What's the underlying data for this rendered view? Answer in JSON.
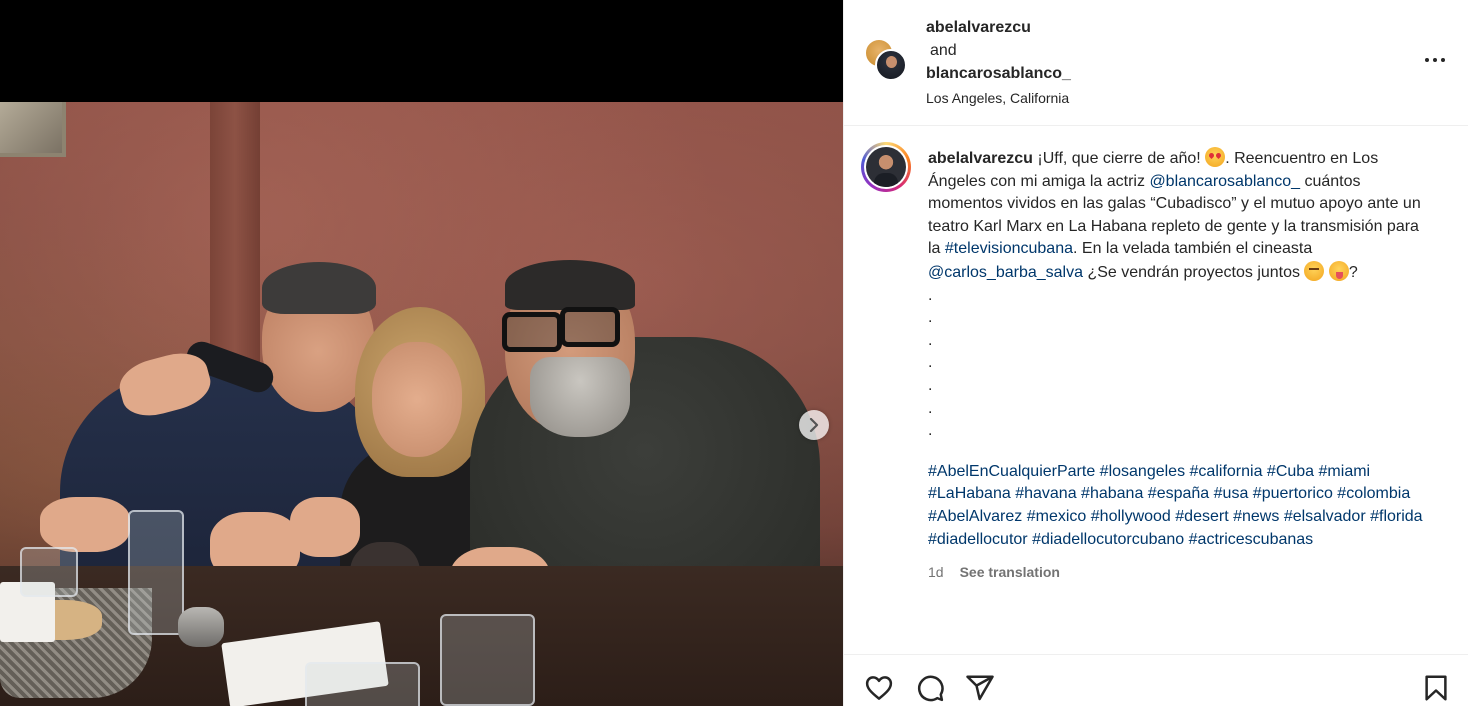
{
  "header": {
    "user1": "abelalvarezcu",
    "and_text": "and",
    "user2": "blancarosablanco_",
    "location": "Los Angeles, California"
  },
  "caption": {
    "username": "abelalvarezcu",
    "seg1": " ¡Uff, que cierre de año! ",
    "seg2": ". Reencuentro en Los Ángeles con mi amiga la actriz ",
    "mention1": "@blancarosablanco_",
    "seg3": " cuántos momentos vividos en las galas “Cubadisco” y el mutuo apoyo ante un teatro Karl Marx en La Habana repleto de gente y la transmisión para la ",
    "hashtag1": "#televisioncubana",
    "seg4": ". En la velada también el cineasta ",
    "mention2": "@carlos_barba_salva",
    "seg5": " ¿Se vendrán proyectos juntos ",
    "seg6": "?",
    "dots": [
      ".",
      ".",
      ".",
      ".",
      ".",
      ".",
      "."
    ],
    "hashtags": [
      "#AbelEnCualquierParte",
      "#losangeles",
      "#california",
      "#Cuba",
      "#miami",
      "#LaHabana",
      "#havana",
      "#habana",
      "#españa",
      "#usa",
      "#puertorico",
      "#colombia",
      "#AbelAlvarez",
      "#mexico",
      "#hollywood",
      "#desert",
      "#news",
      "#elsalvador",
      "#florida",
      "#diadellocutor",
      "#diadellocutorcubano",
      "#actricescubanas"
    ],
    "timestamp": "1d",
    "see_translation": "See translation"
  },
  "icons": {
    "like": "heart-icon",
    "comment": "comment-icon",
    "share": "share-icon",
    "save": "bookmark-icon",
    "more": "more-icon",
    "next": "chevron-right-icon"
  },
  "colors": {
    "link": "#00376b",
    "muted": "#737373",
    "text": "#262626"
  }
}
